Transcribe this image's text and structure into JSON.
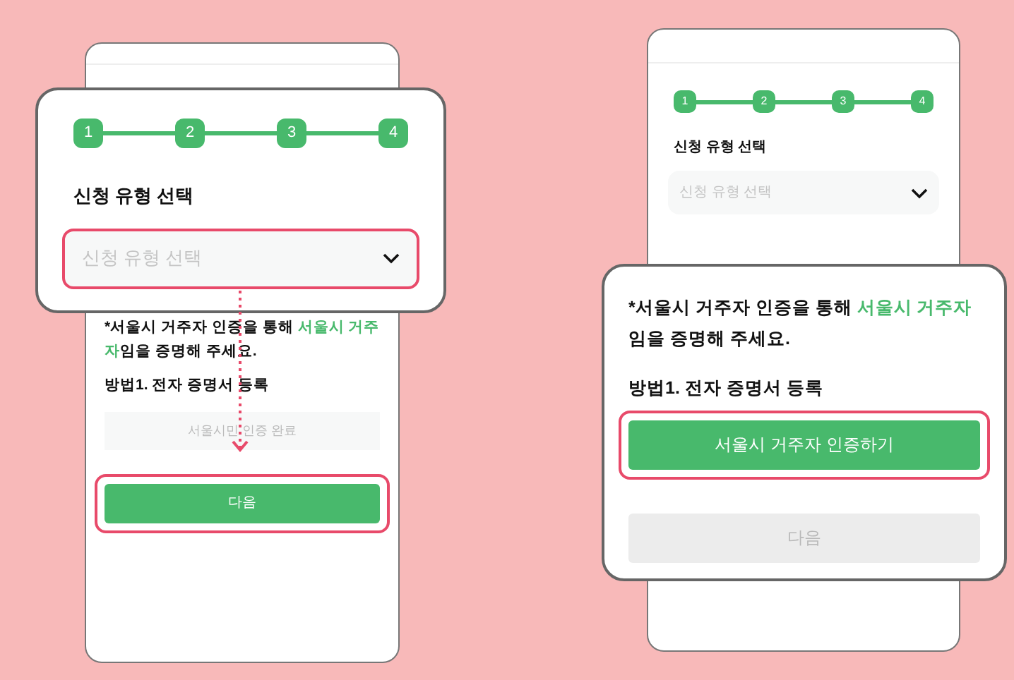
{
  "left_screen": {
    "notice": [
      {
        "text": "*서울시 거주자 인증을 통해 ",
        "highlight": false
      },
      {
        "text": "서울시 거주자",
        "highlight": true
      },
      {
        "text": "임을 증명해 주세요.",
        "highlight": false
      }
    ],
    "method_title": "방법1. 전자 증명서 등록",
    "status_field": {
      "value": "서울시민 인증 완료"
    },
    "next_button": {
      "label": "다음",
      "disabled": false,
      "highlighted": true
    }
  },
  "left_callout": {
    "steps": [
      "1",
      "2",
      "3",
      "4"
    ],
    "section_title": "신청 유형 선택",
    "select": {
      "placeholder": "신청 유형 선택",
      "highlighted": true
    }
  },
  "right_screen": {
    "steps": [
      "1",
      "2",
      "3",
      "4"
    ],
    "section_title": "신청 유형 선택",
    "select": {
      "placeholder": "신청 유형 선택",
      "highlighted": false
    }
  },
  "right_callout": {
    "notice": [
      {
        "text": "*서울시 거주자 인증을 통해 ",
        "highlight": false
      },
      {
        "text": "서울시 거주자",
        "highlight": true
      },
      {
        "text": "임을 증명해 주세요.",
        "highlight": false
      }
    ],
    "method_title": "방법1. 전자 증명서 등록",
    "verify_button": {
      "label": "서울시 거주자 인증하기",
      "disabled": false,
      "highlighted": true
    },
    "next_button": {
      "label": "다음",
      "disabled": true,
      "highlighted": false
    }
  }
}
